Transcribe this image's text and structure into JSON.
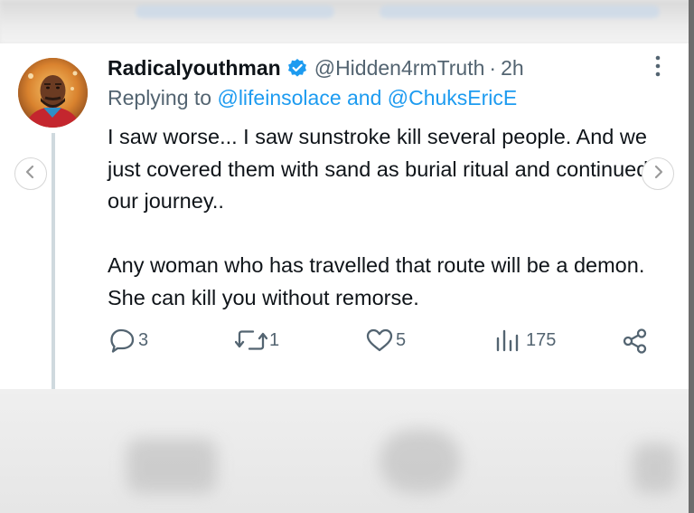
{
  "tweet": {
    "author_name": "Radicalyouthman",
    "author_handle": "@Hidden4rmTruth",
    "separator": "·",
    "time": "2h",
    "replying_prefix": "Replying to",
    "reply_handle_1": "@lifeinsolace",
    "reply_and": "and",
    "reply_handle_2": "@ChuksEricE",
    "paragraph_1": "I saw worse... I saw sunstroke kill several people. And we just covered them with sand as burial ritual  and continued our journey..",
    "paragraph_2": "Any woman who has travelled that route will be a demon. She can kill you without remorse."
  },
  "actions": {
    "replies": "3",
    "reposts": "1",
    "likes": "5",
    "views": "175"
  },
  "icons": {
    "verified": "verified-badge-icon",
    "more": "more-vertical-icon",
    "reply": "reply-icon",
    "repost": "repost-icon",
    "like": "heart-icon",
    "views": "views-icon",
    "share": "share-icon",
    "prev": "chevron-left-icon",
    "next": "chevron-right-icon"
  },
  "colors": {
    "accent": "#1d9bf0",
    "text_primary": "#0f1419",
    "text_secondary": "#536471",
    "thread_line": "#cfd9de"
  }
}
